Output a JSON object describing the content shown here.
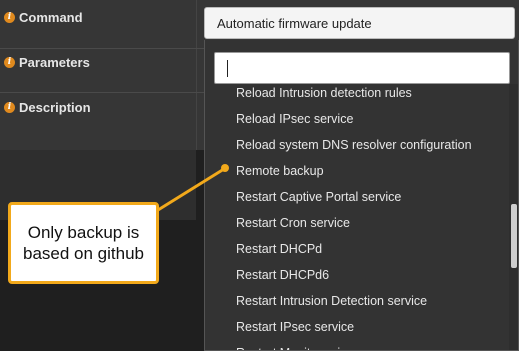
{
  "form": {
    "command_label": "Command",
    "parameters_label": "Parameters",
    "description_label": "Description",
    "command_value": "Automatic firmware update"
  },
  "dropdown": {
    "search_value": "",
    "items": [
      "Reload Intrusion detection rules",
      "Reload IPsec service",
      "Reload system DNS resolver configuration",
      "Remote backup",
      "Restart Captive Portal service",
      "Restart Cron service",
      "Restart DHCPd",
      "Restart DHCPd6",
      "Restart Intrusion Detection service",
      "Restart IPsec service",
      "Restart Monit service"
    ]
  },
  "annotation": {
    "text": "Only backup is based on github",
    "color": "#f2a91b"
  },
  "icons": {
    "info": "info-icon"
  },
  "colors": {
    "accent": "#e08a1e",
    "callout_border": "#f2a91b"
  }
}
